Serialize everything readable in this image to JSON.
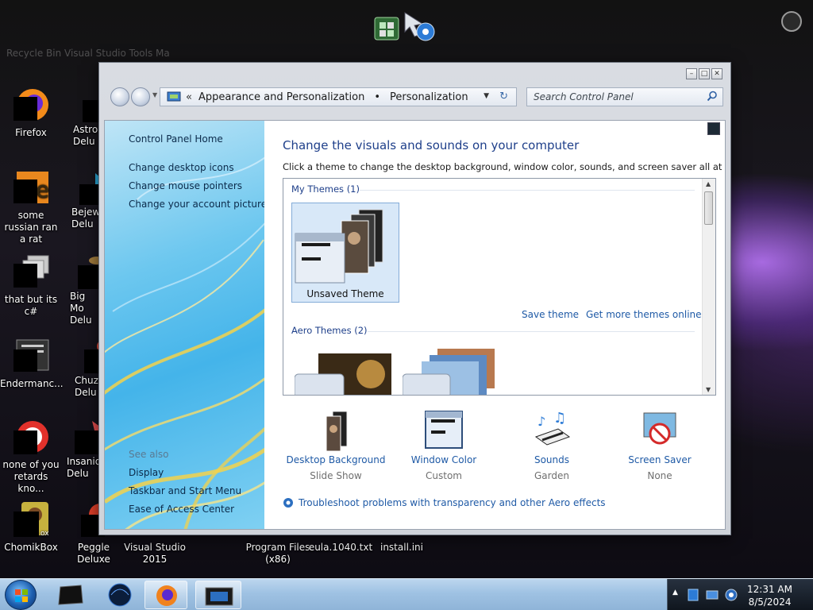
{
  "desktop": {
    "icons": [
      {
        "label": "Firefox"
      },
      {
        "label": "some russian ran a rat"
      },
      {
        "label": "that but its c#"
      },
      {
        "label": "Endermanc..."
      },
      {
        "label": "none of you retards kno..."
      },
      {
        "label": "ChomikBox"
      },
      {
        "label": "Astro Delu"
      },
      {
        "label": "Bejew Delu"
      },
      {
        "label": "Big Mo Delu"
      },
      {
        "label": "Chuz Delu"
      },
      {
        "label": "Insaniq Delu"
      },
      {
        "label": "Peggle Deluxe"
      },
      {
        "label": "Visual Studio 2015"
      },
      {
        "label": "Program Files (x86)"
      },
      {
        "label": "eula.1040.txt"
      },
      {
        "label": "install.ini"
      }
    ],
    "top_faded_text": "Recycle Bin   Visual Studio Tools   Ma"
  },
  "window": {
    "controls": {
      "minimize": "–",
      "maximize": "□",
      "close": "✕"
    },
    "address": {
      "chevron": "«",
      "crumb_1": "Appearance and Personalization",
      "separator": "•",
      "crumb_2": "Personalization"
    },
    "search_placeholder": "Search Control Panel",
    "left_pane": {
      "home": "Control Panel Home",
      "links": [
        "Change desktop icons",
        "Change mouse pointers",
        "Change your account picture"
      ],
      "see_also_heading": "See also",
      "see_also": [
        "Display",
        "Taskbar and Start Menu",
        "Ease of Access Center"
      ]
    },
    "content": {
      "title": "Change the visuals and sounds on your computer",
      "description": "Click a theme to change the desktop background, window color, sounds, and screen saver all at once.",
      "my_themes_label": "My Themes (1)",
      "unsaved_theme": "Unsaved Theme",
      "save_theme": "Save theme",
      "get_more": "Get more themes online",
      "aero_themes_label": "Aero Themes (2)",
      "bottom": [
        {
          "title": "Desktop Background",
          "sub": "Slide Show"
        },
        {
          "title": "Window Color",
          "sub": "Custom"
        },
        {
          "title": "Sounds",
          "sub": "Garden"
        },
        {
          "title": "Screen Saver",
          "sub": "None"
        }
      ],
      "troubleshoot": "Troubleshoot problems with transparency and other Aero effects"
    }
  },
  "taskbar": {
    "clock_time": "12:31 AM",
    "clock_date": "8/5/2024",
    "tray_arrow": "▲"
  },
  "colors": {
    "link_blue": "#1f5aa6",
    "heading_blue": "#1e3f8a",
    "taskbar_blue": "#9fc2e3"
  }
}
